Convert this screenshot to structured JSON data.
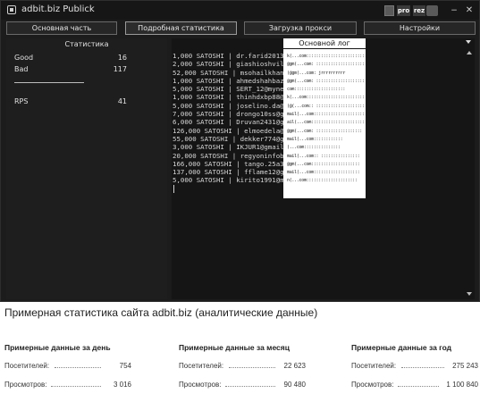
{
  "window": {
    "title": "adbit.biz Publick",
    "buttons": {
      "pro": "pro",
      "rez": "rez",
      "minimize": "−",
      "close": "✕"
    }
  },
  "tabs": [
    {
      "label": "Основная часть"
    },
    {
      "label": "Подробная статистика",
      "active": true
    },
    {
      "label": "Загрузка прокси"
    },
    {
      "label": "Настройки"
    }
  ],
  "stats": {
    "title": "Статистика",
    "good_label": "Good",
    "good_value": "16",
    "bad_label": "Bad",
    "bad_value": "117",
    "rps_label": "RPS",
    "rps_value": "41"
  },
  "log": {
    "title": "Основной лог",
    "lines": [
      "1,000 SATOSHI | dr.farid2013@",
      "2,000 SATOSHI | giashioshvili",
      "52,000 SATOSHI | msohailkhan1",
      "1,000 SATOSHI | ahmedshahbaze",
      "5,000 SATOSHI | SERT_12@mynet",
      "1,000 SATOSHI | thinhdxbp88@g",
      "5,000 SATOSHI | joselino.da@",
      "7,000 SATOSHI | drongo10ss@gm",
      "6,000 SATOSHI | Druvan2431@gm",
      "126,000 SATOSHI | elmoedela@",
      "55,000 SATOSHI | dekker774@gm",
      "3,000 SATOSHI | IKJUR1@gmail",
      "20,000 SATOSHI | regyoninfobi",
      "166,000 SATOSHI | tango.25a3q",
      "137,000 SATOSHI | fflame12@gm",
      "5,000 SATOSHI | kirito1991@ms"
    ],
    "overlay_lines": [
      "k(...com:::::::::::::::::::::::::",
      "@gm(...com: ::::::::::::::::::::::",
      "(@gm(...com: jrrrrrrrrrr",
      "@gm(...com: ::::::::::::::::::::",
      "com:::::::::::::::::::::",
      "k(...com::::::::::::::::::::::::",
      "(@(...com:: ::::::::::::::::::::",
      "mail(...com::::::::::::::::::::::",
      "ail(...com:::::::::::::::::::::::",
      "@gm(...com: :::::::::::::::::::",
      "mail(...com::::::::::::",
      "(...com:::::::::::::::",
      "mail(...com:: ::::::::::::::::",
      "@gm(...com::::::::::::::::::::",
      "mail(...com:::::::::::::::::::",
      "n(...com:::::::::::::::::::::"
    ]
  },
  "article": {
    "title": "Примерная статистика сайта adbit.biz (аналитические данные)",
    "columns": [
      {
        "heading": "Примерные данные за день",
        "visitors_label": "Посетителей:",
        "visitors_value": "754",
        "views_label": "Просмотров:",
        "views_value": "3 016"
      },
      {
        "heading": "Примерные данные за месяц",
        "visitors_label": "Посетителей:",
        "visitors_value": "22 623",
        "views_label": "Просмотров:",
        "views_value": "90 480"
      },
      {
        "heading": "Примерные данные за год",
        "visitors_label": "Посетителей:",
        "visitors_value": "275 243",
        "views_label": "Просмотров:",
        "views_value": "1 100 840"
      }
    ]
  },
  "colors": {
    "app_background": "#1c1c1c",
    "log_background": "#151515",
    "tab_border": "#6a6a6a",
    "text_light": "#e0e0e0"
  },
  "icons": [
    "app-icon",
    "square-icon",
    "camera-icon",
    "minimize-icon",
    "close-icon",
    "dropdown-caret-icon",
    "scroll-up-icon",
    "scroll-down-icon"
  ]
}
